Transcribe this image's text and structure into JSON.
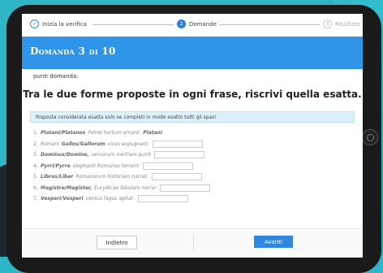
{
  "stepper": {
    "steps": [
      {
        "label": "Inizia la verifica",
        "icon": "check-icon",
        "state": "done"
      },
      {
        "label": "Domande",
        "number": "2",
        "state": "active"
      },
      {
        "label": "Risultato",
        "number": "3",
        "state": "pending"
      }
    ]
  },
  "header": {
    "title": "Domanda 3 di 10"
  },
  "content": {
    "punti_label": "punti domanda:",
    "question": "Tra le due forme proposte in ogni frase, riscrivi quella esatta.",
    "info": "Risposta considerata esatta solo se completi in modo esatto tutti gli spazi"
  },
  "items": [
    {
      "num": "1.",
      "forms": "Platani/Platanos",
      "text": "Petrei hortum ornant.",
      "answer": "Platani"
    },
    {
      "num": "2.",
      "forms": "Gallos/Gallorum",
      "text": "vicos expugnant.",
      "prefix": "Romani"
    },
    {
      "num": "3.",
      "forms": "Dominus/Domine,",
      "text": "servorum inertiam punit"
    },
    {
      "num": "4.",
      "forms": "Pyrri/Pyrre",
      "text": "elephanti Romanos terrent."
    },
    {
      "num": "5.",
      "forms": "Librus/Liber",
      "text": "Romanorum historiam narrat."
    },
    {
      "num": "6.",
      "forms": "Magistre/Magister,",
      "text": "Eurydicae fabulam narra!"
    },
    {
      "num": "7.",
      "forms": "Vesperi/Vesperi",
      "text": "ventus fagos agitat."
    }
  ],
  "footer": {
    "back_label": "Indietro",
    "next_label": "Avanti"
  }
}
